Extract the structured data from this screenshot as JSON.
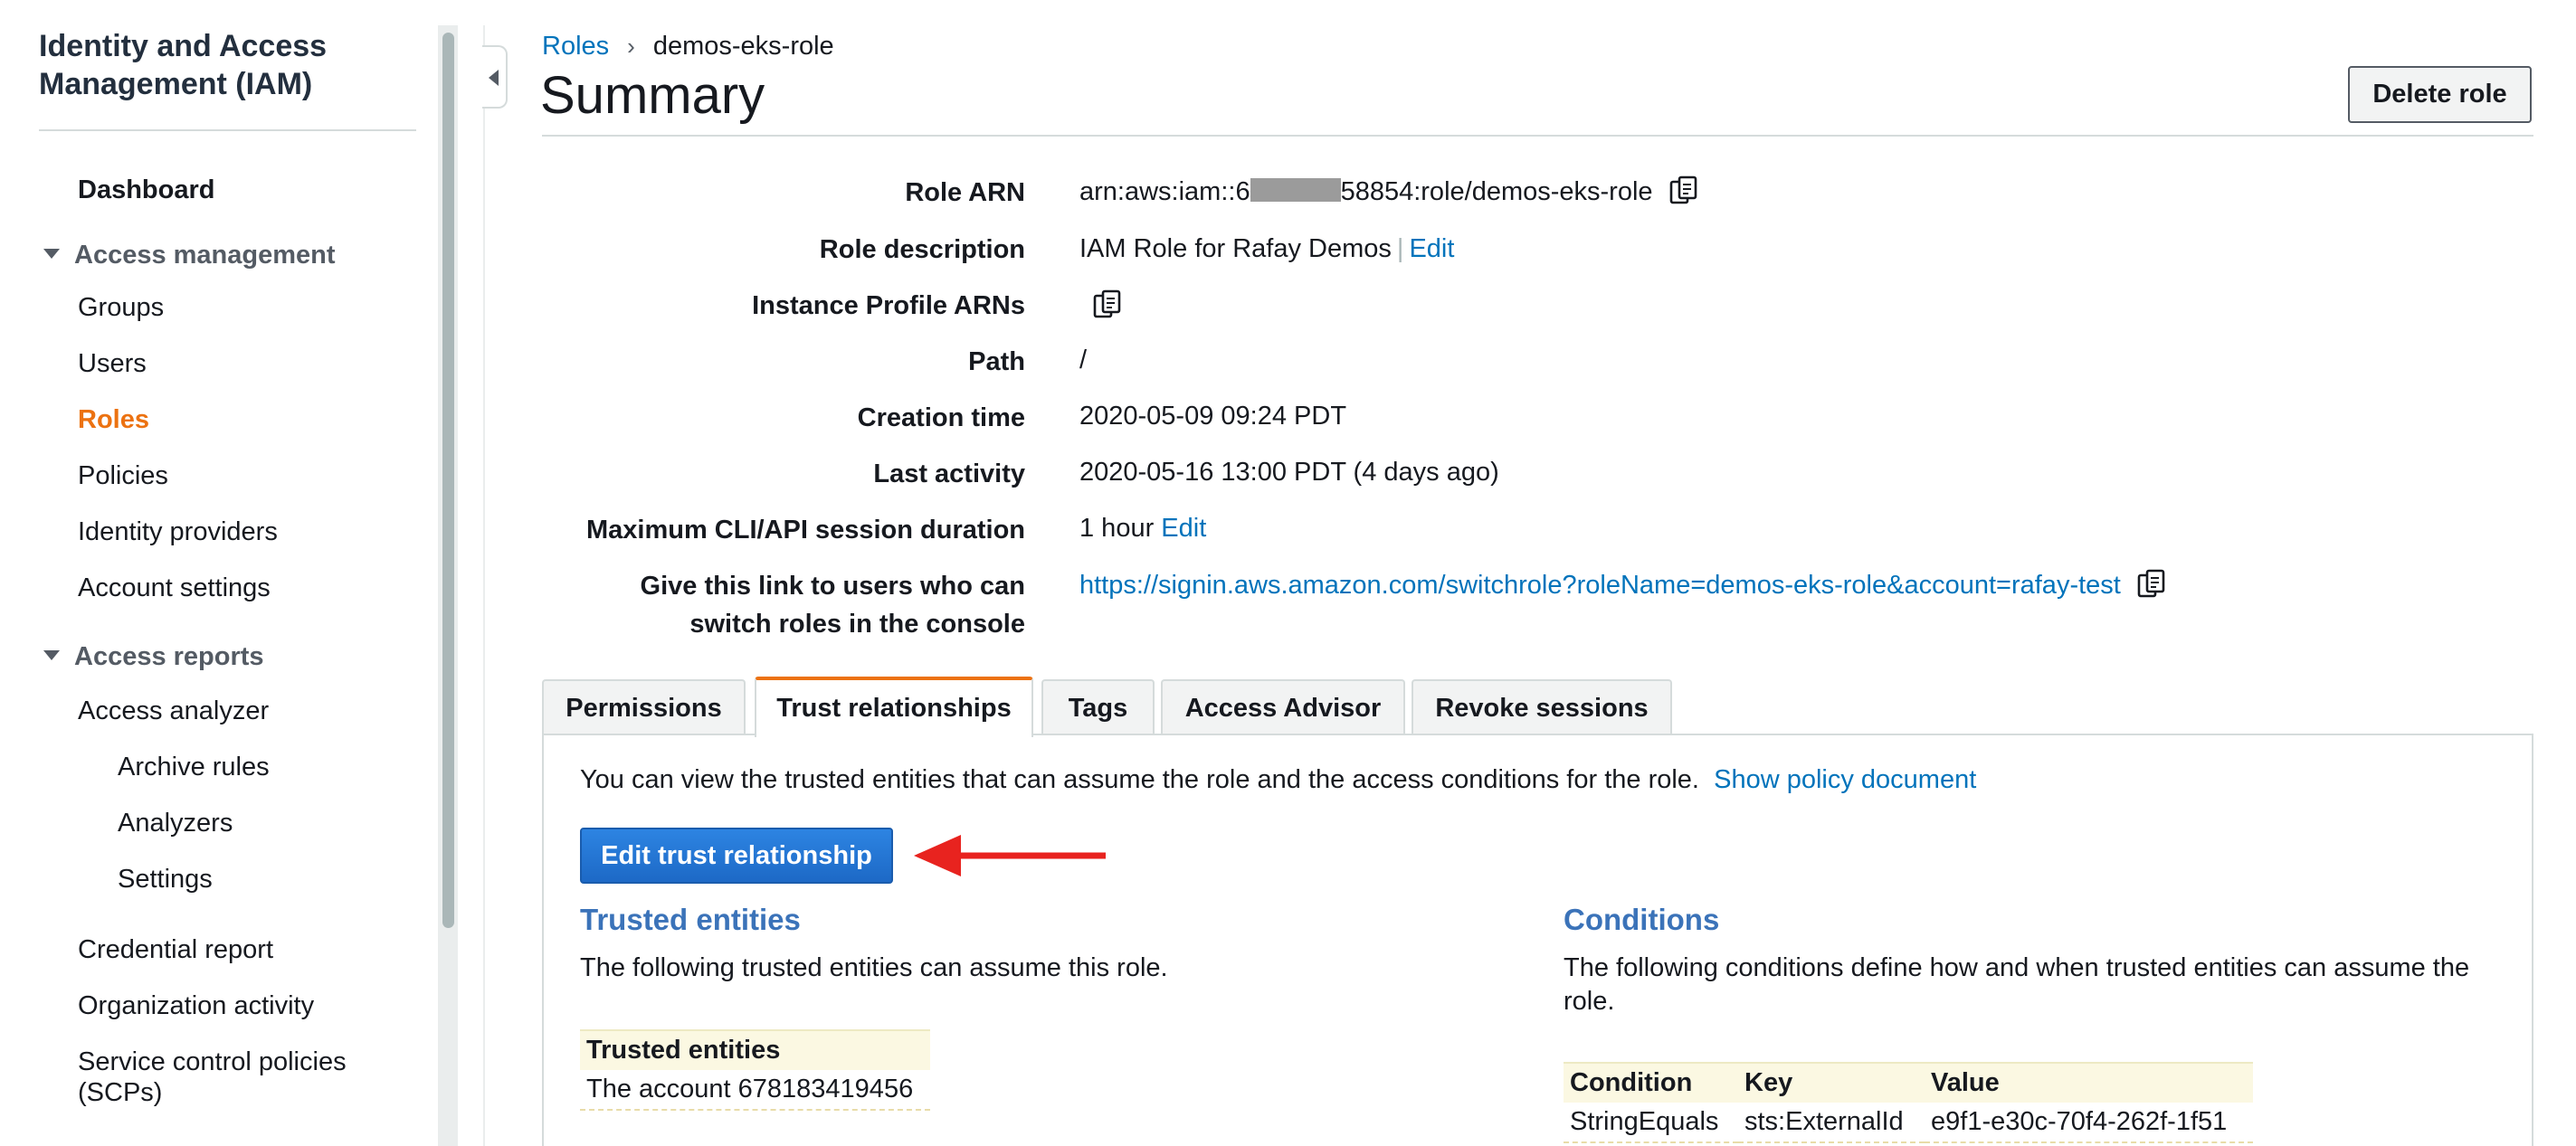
{
  "sidebar": {
    "title": "Identity and Access Management (IAM)",
    "dashboard": "Dashboard",
    "access_management": {
      "label": "Access management",
      "items": [
        "Groups",
        "Users",
        "Roles",
        "Policies",
        "Identity providers",
        "Account settings"
      ]
    },
    "access_reports": {
      "label": "Access reports",
      "analyzer": "Access analyzer",
      "analyzer_children": [
        "Archive rules",
        "Analyzers",
        "Settings"
      ],
      "items": [
        "Credential report",
        "Organization activity",
        "Service control policies (SCPs)"
      ]
    },
    "active_item": "Roles"
  },
  "breadcrumb": {
    "parent": "Roles",
    "separator": "›",
    "current": "demos-eks-role"
  },
  "page_title": "Summary",
  "delete_role_label": "Delete role",
  "summary": {
    "role_arn_label": "Role ARN",
    "role_arn_prefix": "arn:aws:iam::6",
    "role_arn_suffix": "58854:role/demos-eks-role",
    "role_description_label": "Role description",
    "role_description_value": "IAM Role for Rafay Demos",
    "pipe": "|",
    "edit_label": "Edit",
    "instance_profile_label": "Instance Profile ARNs",
    "path_label": "Path",
    "path_value": "/",
    "creation_time_label": "Creation time",
    "creation_time_value": "2020-05-09 09:24 PDT",
    "last_activity_label": "Last activity",
    "last_activity_value": "2020-05-16 13:00 PDT (4 days ago)",
    "max_session_label": "Maximum CLI/API session duration",
    "max_session_value": "1 hour",
    "switch_link_label_line1": "Give this link to users who can",
    "switch_link_label_line2": "switch roles in the console",
    "switch_link_url": "https://signin.aws.amazon.com/switchrole?roleName=demos-eks-role&account=rafay-test"
  },
  "tabs": [
    "Permissions",
    "Trust relationships",
    "Tags",
    "Access Advisor",
    "Revoke sessions"
  ],
  "active_tab": "Trust relationships",
  "trust_panel": {
    "intro": "You can view the trusted entities that can assume the role and the access conditions for the role.",
    "show_policy_link": "Show policy document",
    "edit_button": "Edit trust relationship",
    "trusted_heading": "Trusted entities",
    "trusted_text": "The following trusted entities can assume this role.",
    "trusted_table_header": "Trusted entities",
    "trusted_table_rows": [
      "The account 678183419456"
    ],
    "conditions_heading": "Conditions",
    "conditions_text": "The following conditions define how and when trusted entities can assume the role.",
    "conditions_headers": [
      "Condition",
      "Key",
      "Value"
    ],
    "conditions_rows": [
      [
        "StringEquals",
        "sts:ExternalId",
        "e9f1-e30c-70f4-262f-1f51"
      ]
    ]
  },
  "colors": {
    "link": "#0073bb",
    "active_nav": "#ec7211",
    "primary_button": "#1d69c6",
    "arrow": "#e8231f",
    "section_heading": "#3b73b9"
  },
  "icons": [
    "copy-icon",
    "caret-down-icon",
    "collapse-arrow-icon",
    "red-arrow-annotation"
  ]
}
